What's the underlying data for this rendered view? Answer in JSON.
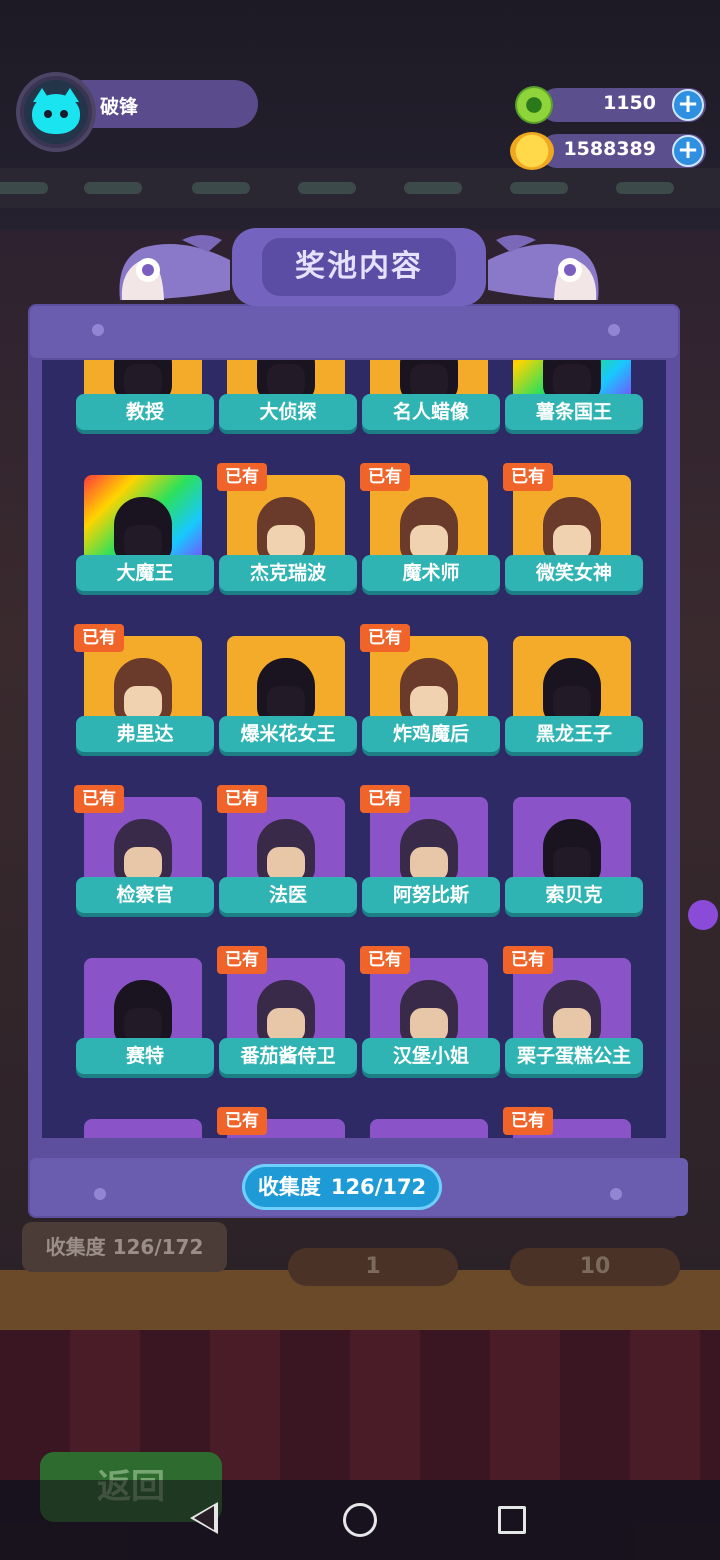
{
  "player": {
    "name": "破锋"
  },
  "currencies": [
    {
      "icon": "green-coin-icon",
      "value": "1150"
    },
    {
      "icon": "gold-planet-coin-icon",
      "value": "1588389"
    }
  ],
  "panel": {
    "title": "奖池内容",
    "owned_badge": "已有",
    "collection_label": "收集度",
    "collection_value": "126/172"
  },
  "cards": [
    {
      "name": "教授",
      "owned": false,
      "frame": "gold"
    },
    {
      "name": "大侦探",
      "owned": false,
      "frame": "gold"
    },
    {
      "name": "名人蜡像",
      "owned": false,
      "frame": "gold"
    },
    {
      "name": "薯条国王",
      "owned": false,
      "frame": "rainbow"
    },
    {
      "name": "大魔王",
      "owned": false,
      "frame": "rainbow"
    },
    {
      "name": "杰克瑞波",
      "owned": true,
      "frame": "gold"
    },
    {
      "name": "魔术师",
      "owned": true,
      "frame": "gold"
    },
    {
      "name": "微笑女神",
      "owned": true,
      "frame": "gold"
    },
    {
      "name": "弗里达",
      "owned": true,
      "frame": "gold"
    },
    {
      "name": "爆米花女王",
      "owned": false,
      "frame": "gold"
    },
    {
      "name": "炸鸡魔后",
      "owned": true,
      "frame": "gold"
    },
    {
      "name": "黑龙王子",
      "owned": false,
      "frame": "gold"
    },
    {
      "name": "检察官",
      "owned": true,
      "frame": "purple"
    },
    {
      "name": "法医",
      "owned": true,
      "frame": "purple"
    },
    {
      "name": "阿努比斯",
      "owned": true,
      "frame": "purple"
    },
    {
      "name": "索贝克",
      "owned": false,
      "frame": "purple"
    },
    {
      "name": "赛特",
      "owned": false,
      "frame": "purple"
    },
    {
      "name": "番茄酱侍卫",
      "owned": true,
      "frame": "purple"
    },
    {
      "name": "汉堡小姐",
      "owned": true,
      "frame": "purple"
    },
    {
      "name": "栗子蛋糕公主",
      "owned": true,
      "frame": "purple"
    },
    {
      "name": "",
      "owned": false,
      "frame": "purple"
    },
    {
      "name": "",
      "owned": true,
      "frame": "purple"
    },
    {
      "name": "",
      "owned": false,
      "frame": "purple"
    },
    {
      "name": "",
      "owned": true,
      "frame": "purple"
    }
  ],
  "background": {
    "collection_label": "收集度",
    "collection_value": "126/172",
    "pickle_values": [
      "1",
      "10"
    ],
    "back_button": "返回"
  }
}
